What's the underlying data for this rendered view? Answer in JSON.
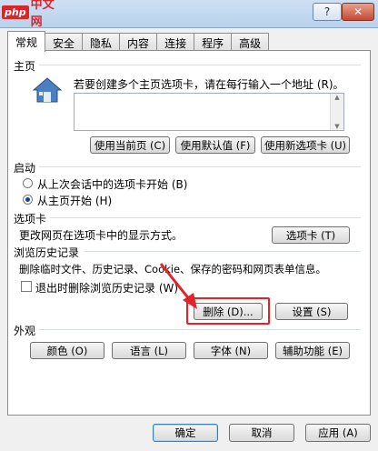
{
  "logo": {
    "php": "php",
    "cn": "中文网"
  },
  "window": {
    "help_btn": "?",
    "close_btn": "✕"
  },
  "tabs": [
    "常规",
    "安全",
    "隐私",
    "内容",
    "连接",
    "程序",
    "高级"
  ],
  "home": {
    "title": "主页",
    "desc": "若要创建多个主页选项卡，请在每行输入一个地址 (R)。",
    "url_value": "",
    "btn_current": "使用当前页 (C)",
    "btn_default": "使用默认值 (F)",
    "btn_new_tab": "使用新选项卡 (U)"
  },
  "startup": {
    "title": "启动",
    "opt_last": "从上次会话中的选项卡开始 (B)",
    "opt_home": "从主页开始 (H)",
    "selected": "opt_home"
  },
  "tabsection": {
    "title": "选项卡",
    "desc": "更改网页在选项卡中的显示方式。",
    "btn": "选项卡 (T)"
  },
  "history": {
    "title": "浏览历史记录",
    "desc": "删除临时文件、历史记录、Cookie、保存的密码和网页表单信息。",
    "checkbox_label": "退出时删除浏览历史记录 (W)",
    "checkbox_checked": false,
    "btn_delete": "删除 (D)...",
    "btn_settings": "设置 (S)"
  },
  "appearance": {
    "title": "外观",
    "btn_colors": "颜色 (O)",
    "btn_lang": "语言 (L)",
    "btn_fonts": "字体 (N)",
    "btn_access": "辅助功能 (E)"
  },
  "footer": {
    "ok": "确定",
    "cancel": "取消",
    "apply": "应用 (A)"
  },
  "colors": {
    "highlight": "#e2232a",
    "accent_arrow": "#e2232a"
  }
}
